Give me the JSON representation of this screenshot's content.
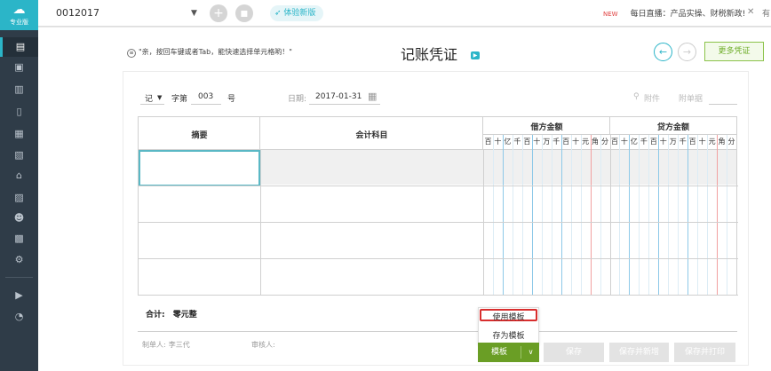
{
  "sidebar": {
    "logo_glyph": "☁",
    "logo_text": "专业版",
    "icons": [
      "voucher-icon",
      "ledger-icon",
      "report-chart-icon",
      "book-icon",
      "calendar-icon",
      "document-icon",
      "asset-icon",
      "image-icon",
      "people-icon",
      "checklist-icon",
      "settings-icon",
      "video-icon",
      "speedometer-icon"
    ]
  },
  "topbar": {
    "account": "0012017",
    "dropdown_glyph": "▼",
    "add_glyph": "+",
    "apps_glyph": "▪",
    "try_new": "体验新版",
    "hot_badge": "NEW",
    "news": "每日直播：产品实操、财税新政!",
    "close_glyph": "✕",
    "right_text": "有"
  },
  "page": {
    "tip_icon": "≡",
    "tip": "\"亲，按回车键或者Tab，能快速选择单元格哟！\"",
    "title": "记账凭证",
    "title_icon": "▶",
    "prev_glyph": "←",
    "next_glyph": "→",
    "more_vouchers": "更多凭证"
  },
  "voucher": {
    "type": "记",
    "type_caret": "▼",
    "number_prefix": "字第",
    "number": "003",
    "number_suffix": "号",
    "date_label": "日期:",
    "date": "2017-01-31",
    "calendar_glyph": "▦",
    "attachment_icon": "⚲",
    "attachment": "附件",
    "attachment_count_label": "附单据",
    "attachment_count_value": ""
  },
  "table": {
    "summary": "摘要",
    "account": "会计科目",
    "debit": "借方金额",
    "credit": "贷方金额",
    "units": [
      "百",
      "十",
      "亿",
      "千",
      "百",
      "十",
      "万",
      "千",
      "百",
      "十",
      "元",
      "角",
      "分"
    ]
  },
  "footer": {
    "total_label": "合计:",
    "total_value": "零元整",
    "maker_label": "制单人:",
    "maker": "李三代",
    "reviewer_label": "审核人:",
    "reviewer": ""
  },
  "template_menu": {
    "use": "使用模板",
    "save_as": "存为模板"
  },
  "actions": {
    "template": "模板",
    "template_caret": "∨",
    "save": "保存",
    "save_new": "保存并新增",
    "save_print": "保存并打印"
  }
}
